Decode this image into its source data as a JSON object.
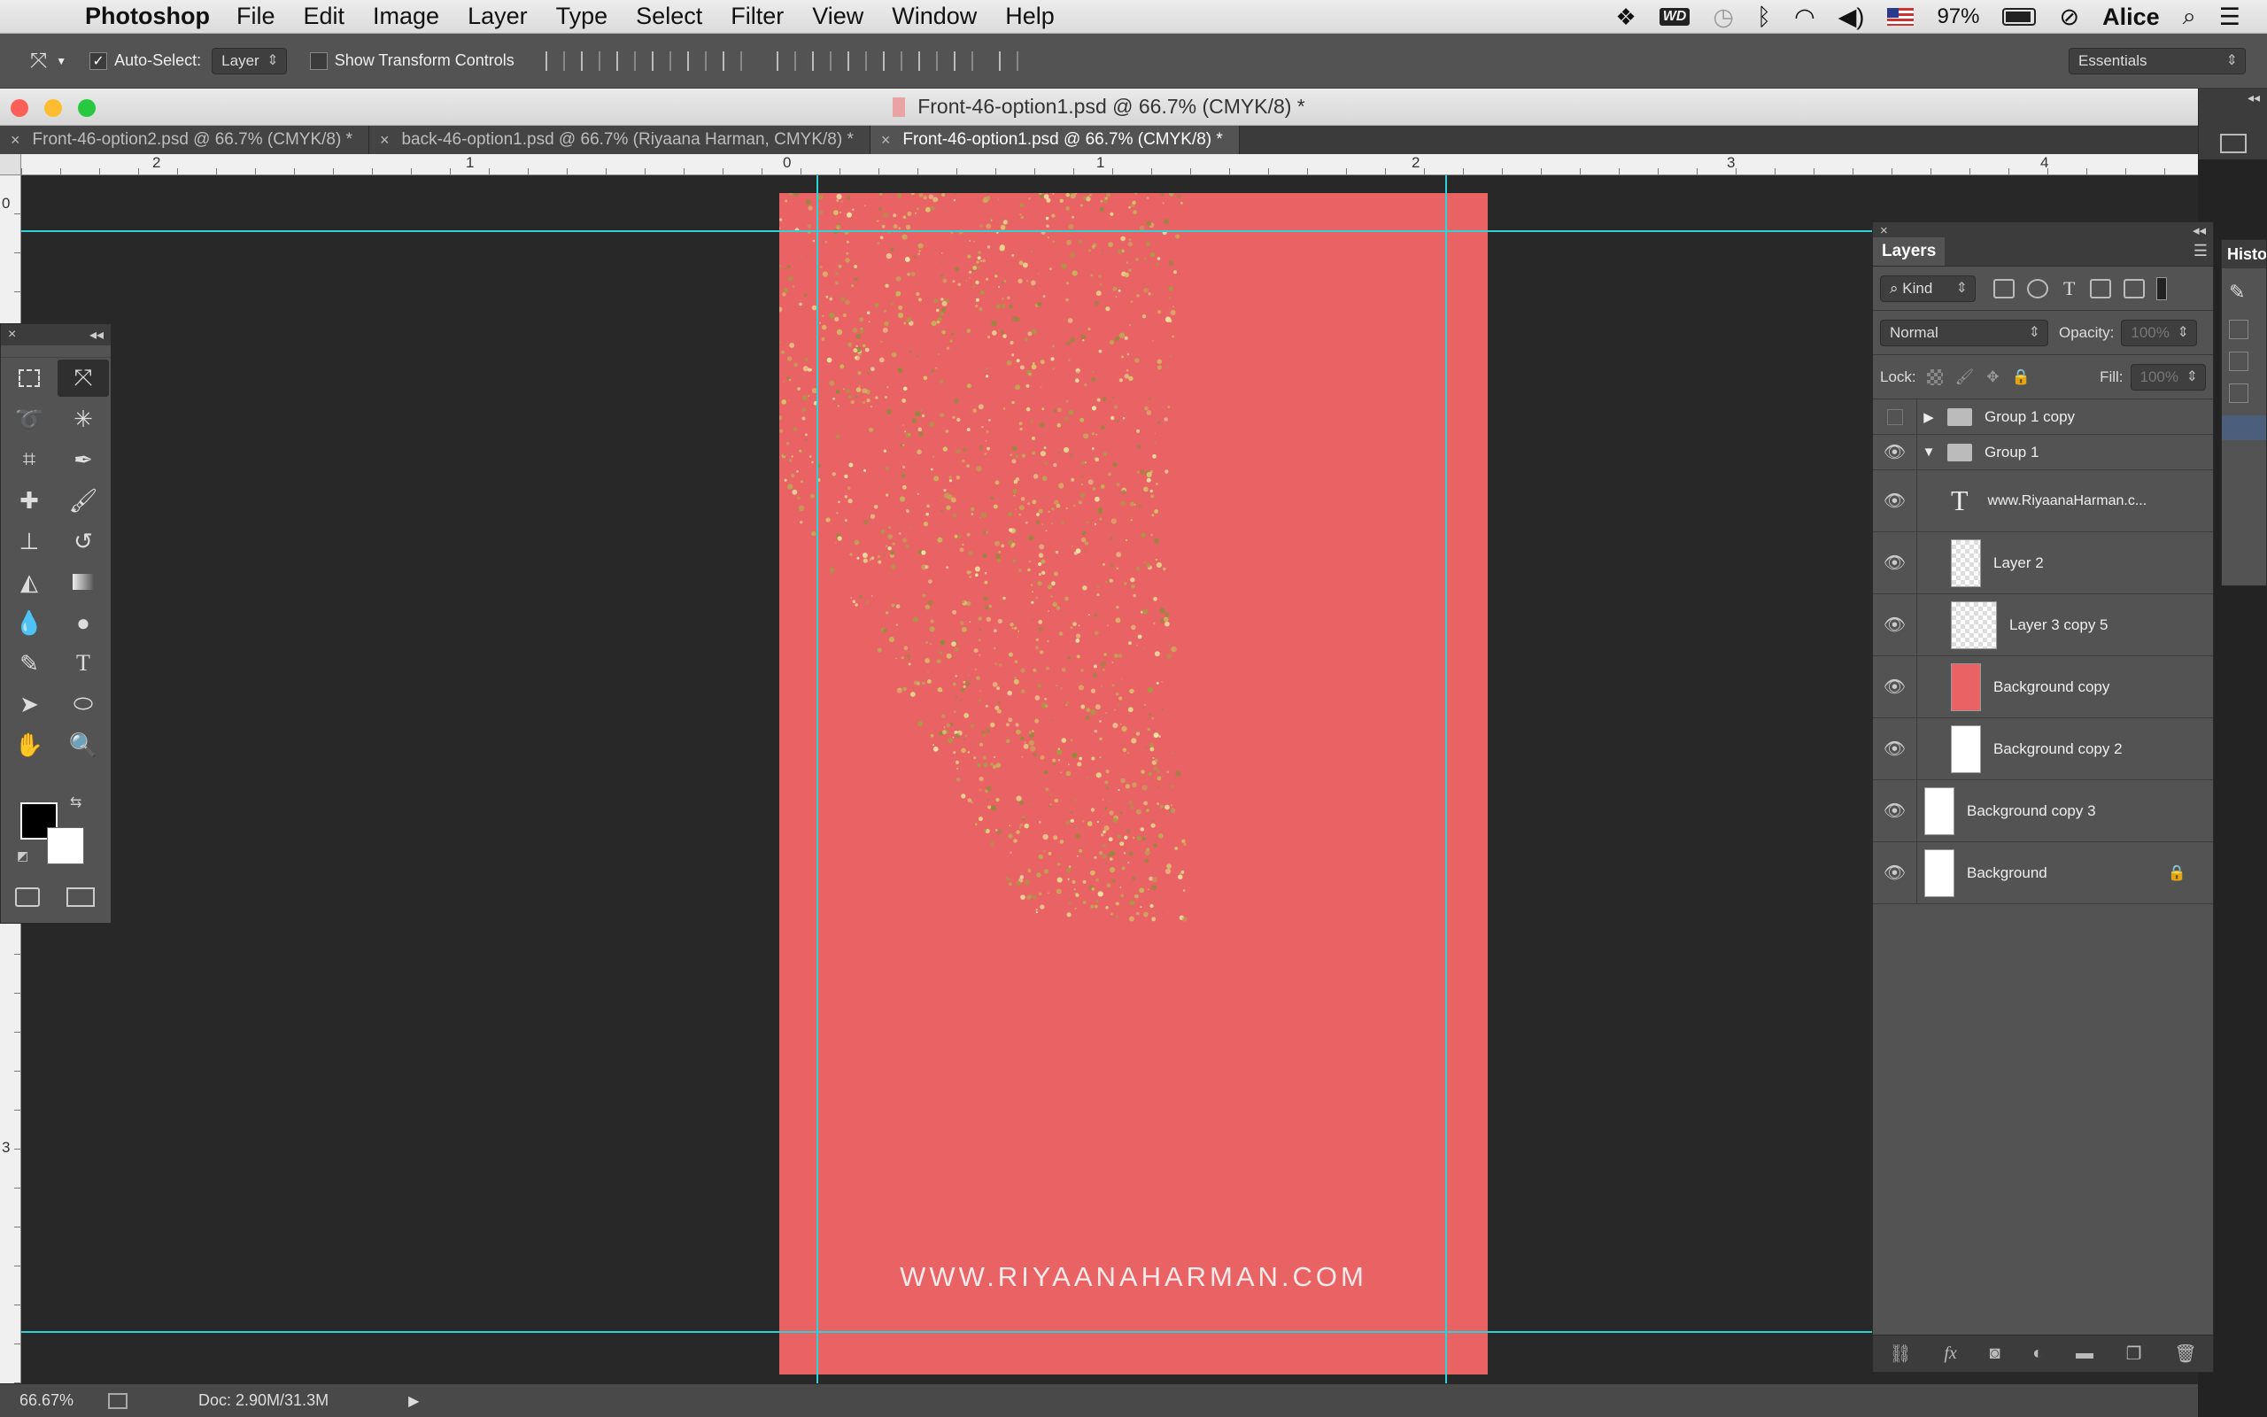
{
  "menubar": {
    "app_name": "Photoshop",
    "menus": [
      "File",
      "Edit",
      "Image",
      "Layer",
      "Type",
      "Select",
      "Filter",
      "View",
      "Window",
      "Help"
    ],
    "battery": "97%",
    "user": "Alice",
    "status_icons": [
      "dropbox-icon",
      "wd-icon",
      "time-machine-icon",
      "bluetooth-icon",
      "wifi-icon",
      "volume-icon",
      "flag-icon",
      "battery-icon",
      "do-not-disturb-icon",
      "spotlight-icon",
      "notification-icon"
    ]
  },
  "options_bar": {
    "auto_select_label": "Auto-Select:",
    "auto_select_checked": true,
    "auto_select_value": "Layer",
    "show_transform_label": "Show Transform Controls",
    "show_transform_checked": false,
    "workspace": "Essentials"
  },
  "document": {
    "title": "Front-46-option1.psd @ 66.7% (CMYK/8) *",
    "tabs": [
      {
        "label": "Front-46-option2.psd @ 66.7% (CMYK/8) *",
        "active": false
      },
      {
        "label": "back-46-option1.psd @ 66.7% (Riyaana Harman, CMYK/8) *",
        "active": false
      },
      {
        "label": "Front-46-option1.psd @ 66.7% (CMYK/8) *",
        "active": true
      }
    ],
    "ruler_top_numbers": [
      "2",
      "1",
      "0",
      "1",
      "2",
      "3",
      "4"
    ],
    "ruler_left_numbers": [
      "0",
      "3"
    ],
    "canvas_color": "#e96264",
    "guide_color": "#2fd0d8",
    "canvas_text": "WWW.RIYAANAHARMAN.COM"
  },
  "status": {
    "zoom": "66.67%",
    "doc_size": "Doc: 2.90M/31.3M"
  },
  "tools": [
    "rectangular-marquee",
    "move",
    "lasso",
    "magic-wand",
    "crop",
    "eyedropper",
    "healing-brush",
    "brush",
    "clone-stamp",
    "history-brush",
    "eraser",
    "gradient",
    "blur",
    "dodge",
    "pen",
    "type",
    "path-selection",
    "ellipse",
    "hand",
    "zoom"
  ],
  "layers_panel": {
    "tab_label": "Layers",
    "filter_kind": "Kind",
    "blend_mode": "Normal",
    "opacity_label": "Opacity:",
    "opacity_value": "100%",
    "lock_label": "Lock:",
    "fill_label": "Fill:",
    "fill_value": "100%",
    "layers": [
      {
        "name": "Group 1 copy",
        "type": "group",
        "visible": false,
        "expanded": false
      },
      {
        "name": "Group 1",
        "type": "group",
        "visible": true,
        "expanded": true
      },
      {
        "name": "www.RiyaanaHarman.c...",
        "type": "text",
        "visible": true
      },
      {
        "name": "Layer 2",
        "type": "pixel-transparent",
        "visible": true
      },
      {
        "name": "Layer 3 copy 5",
        "type": "pixel-transparent",
        "visible": true
      },
      {
        "name": "Background copy",
        "type": "pixel-red",
        "visible": true
      },
      {
        "name": "Background copy 2",
        "type": "pixel-white",
        "visible": true
      },
      {
        "name": "Background copy 3",
        "type": "pixel-white",
        "visible": true
      },
      {
        "name": "Background",
        "type": "pixel-white",
        "visible": true,
        "locked": true
      }
    ]
  },
  "history_panel": {
    "tab_label": "Histo"
  }
}
